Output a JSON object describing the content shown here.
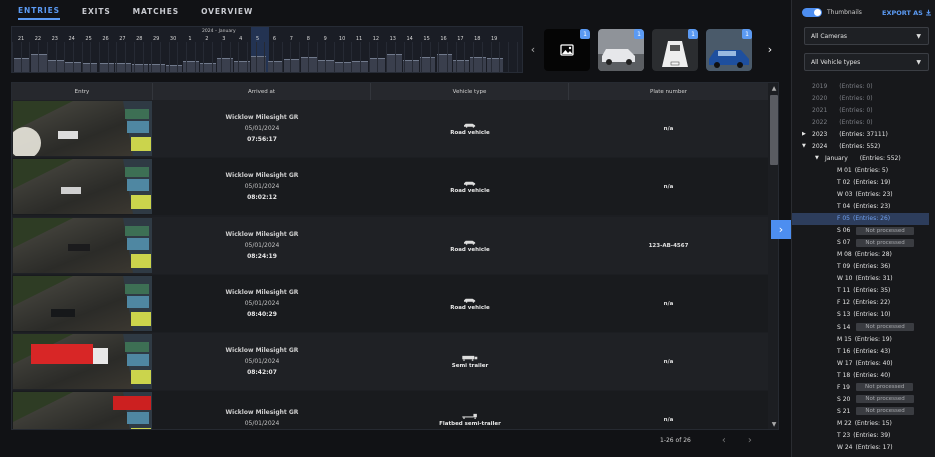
{
  "tabs": [
    "ENTRIES",
    "EXITS",
    "MATCHES",
    "OVERVIEW"
  ],
  "active_tab": "ENTRIES",
  "timeline": {
    "month_label": "2024 – January",
    "labels": [
      "21",
      "22",
      "23",
      "24",
      "25",
      "26",
      "27",
      "28",
      "29",
      "30",
      "1",
      "2",
      "3",
      "4",
      "5",
      "6",
      "7",
      "8",
      "9",
      "10",
      "11",
      "12",
      "13",
      "14",
      "15",
      "16",
      "17",
      "18",
      "19"
    ]
  },
  "thumbnails": [
    {
      "badge": "1",
      "icon": "image-placeholder-icon"
    },
    {
      "badge": "1",
      "icon": ""
    },
    {
      "badge": "1",
      "icon": ""
    },
    {
      "badge": "1",
      "icon": ""
    }
  ],
  "table": {
    "headers": [
      "Entry",
      "Arrived at",
      "Vehicle type",
      "Plate number"
    ],
    "rows": [
      {
        "camera": "Wicklow Milesight GR",
        "date": "05/01/2024",
        "time": "07:56:17",
        "vehicle": "Road vehicle",
        "plate": "n/a"
      },
      {
        "camera": "Wicklow Milesight GR",
        "date": "05/01/2024",
        "time": "08:02:12",
        "vehicle": "Road vehicle",
        "plate": "n/a"
      },
      {
        "camera": "Wicklow Milesight GR",
        "date": "05/01/2024",
        "time": "08:24:19",
        "vehicle": "Road vehicle",
        "plate": "123-AB-4567"
      },
      {
        "camera": "Wicklow Milesight GR",
        "date": "05/01/2024",
        "time": "08:40:29",
        "vehicle": "Road vehicle",
        "plate": "n/a"
      },
      {
        "camera": "Wicklow Milesight GR",
        "date": "05/01/2024",
        "time": "08:42:07",
        "vehicle": "Semi trailer",
        "plate": "n/a"
      },
      {
        "camera": "Wicklow Milesight GR",
        "date": "05/01/2024",
        "time": "",
        "vehicle": "Flatbed semi-trailer",
        "plate": "n/a"
      }
    ],
    "pagination": "1-26 of 26"
  },
  "sidebar": {
    "thumbnails_label": "Thumbnails",
    "thumbnails_on": true,
    "export_label": "EXPORT AS",
    "camera_select": "All Cameras",
    "vehicle_select": "All Vehicle types",
    "tree": [
      {
        "label": "2019",
        "entries": "(Entries: 0)",
        "kind": "year-dim"
      },
      {
        "label": "2020",
        "entries": "(Entries: 0)",
        "kind": "year-dim"
      },
      {
        "label": "2021",
        "entries": "(Entries: 0)",
        "kind": "year-dim"
      },
      {
        "label": "2022",
        "entries": "(Entries: 0)",
        "kind": "year-dim"
      },
      {
        "label": "2023",
        "entries": "(Entries: 37111)",
        "kind": "year",
        "caret": "right"
      },
      {
        "label": "2024",
        "entries": "(Entries: 552)",
        "kind": "year",
        "caret": "down"
      },
      {
        "label": "January",
        "entries": "(Entries: 552)",
        "kind": "month",
        "caret": "down"
      },
      {
        "label": "M 01",
        "entries": "(Entries: 5)",
        "kind": "day"
      },
      {
        "label": "T 02",
        "entries": "(Entries: 19)",
        "kind": "day"
      },
      {
        "label": "W 03",
        "entries": "(Entries: 23)",
        "kind": "day"
      },
      {
        "label": "T 04",
        "entries": "(Entries: 23)",
        "kind": "day"
      },
      {
        "label": "F 05",
        "entries": "(Entries: 26)",
        "kind": "day",
        "selected": true
      },
      {
        "label": "S 06",
        "status": "Not processed",
        "kind": "day"
      },
      {
        "label": "S 07",
        "status": "Not processed",
        "kind": "day"
      },
      {
        "label": "M 08",
        "entries": "(Entries: 28)",
        "kind": "day"
      },
      {
        "label": "T 09",
        "entries": "(Entries: 36)",
        "kind": "day"
      },
      {
        "label": "W 10",
        "entries": "(Entries: 31)",
        "kind": "day"
      },
      {
        "label": "T 11",
        "entries": "(Entries: 35)",
        "kind": "day"
      },
      {
        "label": "F 12",
        "entries": "(Entries: 22)",
        "kind": "day"
      },
      {
        "label": "S 13",
        "entries": "(Entries: 10)",
        "kind": "day"
      },
      {
        "label": "S 14",
        "status": "Not processed",
        "kind": "day"
      },
      {
        "label": "M 15",
        "entries": "(Entries: 19)",
        "kind": "day"
      },
      {
        "label": "T 16",
        "entries": "(Entries: 43)",
        "kind": "day"
      },
      {
        "label": "W 17",
        "entries": "(Entries: 40)",
        "kind": "day"
      },
      {
        "label": "T 18",
        "entries": "(Entries: 40)",
        "kind": "day"
      },
      {
        "label": "F 19",
        "status": "Not processed",
        "kind": "day"
      },
      {
        "label": "S 20",
        "status": "Not processed",
        "kind": "day"
      },
      {
        "label": "S 21",
        "status": "Not processed",
        "kind": "day"
      },
      {
        "label": "M 22",
        "entries": "(Entries: 15)",
        "kind": "day"
      },
      {
        "label": "T 23",
        "entries": "(Entries: 39)",
        "kind": "day"
      },
      {
        "label": "W 24",
        "entries": "(Entries: 17)",
        "kind": "day"
      }
    ]
  },
  "colors": {
    "accent": "#4d8ef0",
    "background": "#111215",
    "panel": "#1c1e22"
  }
}
